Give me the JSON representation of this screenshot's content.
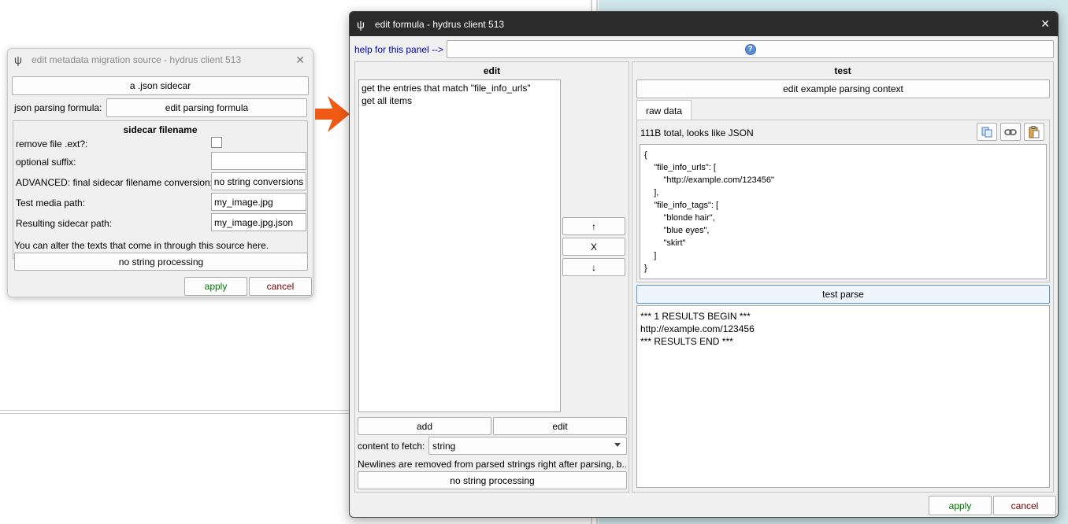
{
  "migration_dialog": {
    "title": "edit metadata migration source - hydrus client 513",
    "source_type_button": "a .json sidecar",
    "parsing_formula_label": "json parsing formula:",
    "edit_parsing_formula_button": "edit parsing formula",
    "sidecar_group_title": "sidecar filename",
    "remove_ext_label": "remove file .ext?:",
    "optional_suffix_label": "optional suffix:",
    "optional_suffix_value": "",
    "advanced_label": "ADVANCED: final sidecar filename conversion:",
    "advanced_button": "no string conversions",
    "test_media_label": "Test media path:",
    "test_media_value": "my_image.jpg",
    "resulting_label": "Resulting sidecar path:",
    "resulting_value": "my_image.jpg.json",
    "alter_text": "You can alter the texts that come in through this source here.",
    "string_processing_button": "no string processing",
    "apply": "apply",
    "cancel": "cancel"
  },
  "formula_dialog": {
    "title": "edit formula - hydrus client 513",
    "help_link": "help for this panel -->",
    "edit_panel": {
      "title": "edit",
      "items": [
        "get the entries that match \"file_info_urls\"",
        "get all items"
      ],
      "move_up": "↑",
      "delete": "X",
      "move_down": "↓",
      "add": "add",
      "edit": "edit",
      "content_label": "content to fetch:",
      "content_value": "string",
      "newlines_note": "Newlines are removed from parsed strings right after parsing, b...",
      "string_processing_button": "no string processing"
    },
    "test_panel": {
      "title": "test",
      "context_button": "edit example parsing context",
      "tab_raw": "raw data",
      "summary": "111B total, looks like JSON",
      "raw_lines": [
        "{",
        "    \"file_info_urls\": [",
        "        \"http://example.com/123456\"",
        "    ],",
        "    \"file_info_tags\": [",
        "        \"blonde hair\",",
        "        \"blue eyes\",",
        "        \"skirt\"",
        "    ]",
        "}"
      ],
      "test_parse_button": "test parse",
      "result_lines": [
        "*** 1 RESULTS BEGIN ***",
        "http://example.com/123456",
        "*** RESULTS END ***"
      ]
    },
    "apply": "apply",
    "cancel": "cancel"
  },
  "colors": {
    "accent_arrow": "#f05a14",
    "apply_text": "#007800",
    "cancel_text": "#780000",
    "titlebar_dark": "#2b2b2b"
  }
}
